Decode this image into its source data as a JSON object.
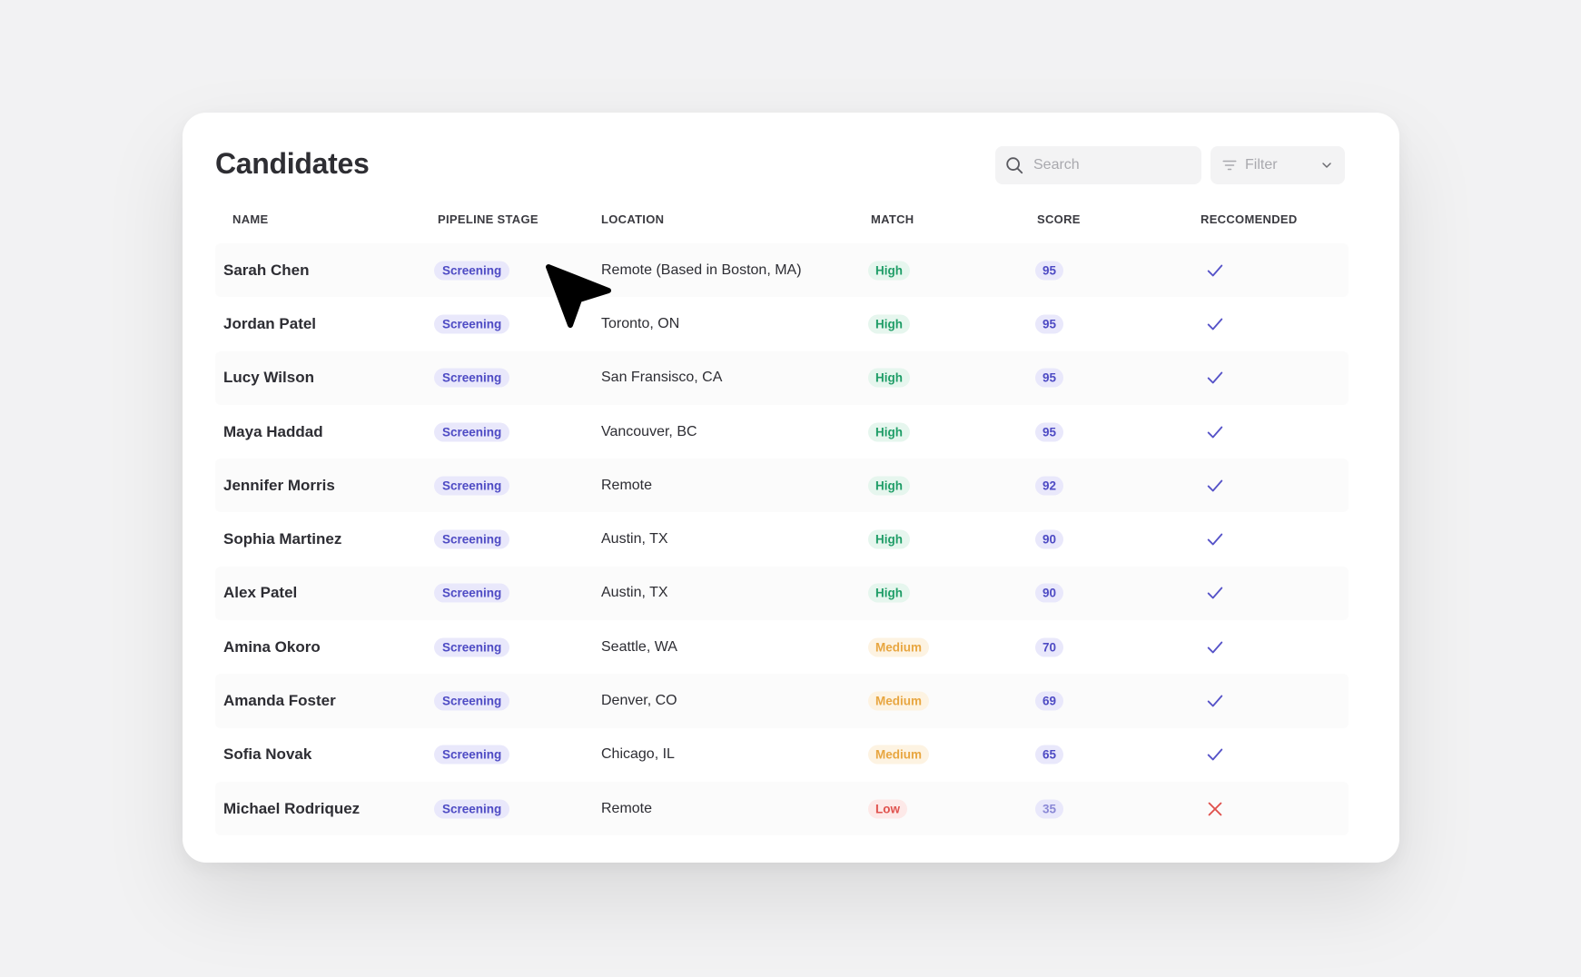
{
  "page": {
    "title": "Candidates"
  },
  "search": {
    "placeholder": "Search"
  },
  "filter": {
    "label": "Filter"
  },
  "columns": [
    "NAME",
    "PIPELINE STAGE",
    "LOCATION",
    "MATCH",
    "SCORE",
    "RECCOMENDED"
  ],
  "rows": [
    {
      "name": "Sarah Chen",
      "stage": "Screening",
      "location": "Remote (Based in Boston, MA)",
      "match": "High",
      "score": "95",
      "recommended": true
    },
    {
      "name": "Jordan Patel",
      "stage": "Screening",
      "location": "Toronto, ON",
      "match": "High",
      "score": "95",
      "recommended": true
    },
    {
      "name": "Lucy Wilson",
      "stage": "Screening",
      "location": "San Fransisco, CA",
      "match": "High",
      "score": "95",
      "recommended": true
    },
    {
      "name": "Maya Haddad",
      "stage": "Screening",
      "location": "Vancouver, BC",
      "match": "High",
      "score": "95",
      "recommended": true
    },
    {
      "name": "Jennifer Morris",
      "stage": "Screening",
      "location": "Remote",
      "match": "High",
      "score": "92",
      "recommended": true
    },
    {
      "name": "Sophia Martinez",
      "stage": "Screening",
      "location": "Austin, TX",
      "match": "High",
      "score": "90",
      "recommended": true
    },
    {
      "name": "Alex Patel",
      "stage": "Screening",
      "location": "Austin, TX",
      "match": "High",
      "score": "90",
      "recommended": true
    },
    {
      "name": "Amina Okoro",
      "stage": "Screening",
      "location": "Seattle, WA",
      "match": "Medium",
      "score": "70",
      "recommended": true
    },
    {
      "name": "Amanda Foster",
      "stage": "Screening",
      "location": "Denver, CO",
      "match": "Medium",
      "score": "69",
      "recommended": true
    },
    {
      "name": "Sofia Novak",
      "stage": "Screening",
      "location": "Chicago, IL",
      "match": "Medium",
      "score": "65",
      "recommended": true
    },
    {
      "name": "Michael Rodriquez",
      "stage": "Screening",
      "location": "Remote",
      "match": "Low",
      "score": "35",
      "recommended": false
    }
  ],
  "icons": {
    "search": "search-icon",
    "filter": "filter-icon",
    "dropdown": "chevron-down-icon",
    "yes": "check-icon",
    "no": "x-icon",
    "pointer": "cursor-arrow-icon"
  },
  "colors": {
    "accent": "#4e4bc4",
    "high": "#1f9d67",
    "medium": "#e8a640",
    "low": "#e0524e"
  }
}
